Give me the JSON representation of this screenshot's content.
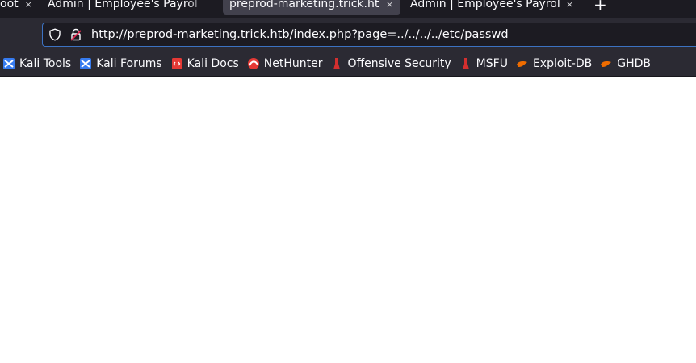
{
  "tabs": [
    {
      "label": "oot",
      "active": false
    },
    {
      "label": "Admin | Employee's Payroll M",
      "active": false
    },
    {
      "label": "preprod-marketing.trick.htb/",
      "active": true
    },
    {
      "label": "Admin | Employee's Payroll M",
      "active": false
    }
  ],
  "new_tab_symbol": "+",
  "close_symbol": "×",
  "urlbar": {
    "url": "http://preprod-marketing.trick.htb/index.php?page=../../../../etc/passwd"
  },
  "bookmarks": [
    {
      "label": "Kali Tools",
      "icon": "kali-dragon-icon"
    },
    {
      "label": "Kali Forums",
      "icon": "kali-dragon-icon"
    },
    {
      "label": "Kali Docs",
      "icon": "kali-docs-icon"
    },
    {
      "label": "NetHunter",
      "icon": "nethunter-icon"
    },
    {
      "label": "Offensive Security",
      "icon": "offsec-icon"
    },
    {
      "label": "MSFU",
      "icon": "offsec-icon"
    },
    {
      "label": "Exploit-DB",
      "icon": "exploitdb-icon"
    },
    {
      "label": "GHDB",
      "icon": "exploitdb-icon"
    }
  ],
  "colors": {
    "tabstrip_bg": "#1c1b22",
    "toolbar_bg": "#2b2a33",
    "urlbar_bg": "#1c1b22",
    "urlbar_focus": "#3c72c2",
    "text": "#fbfbfe",
    "content_bg": "#ffffff"
  }
}
